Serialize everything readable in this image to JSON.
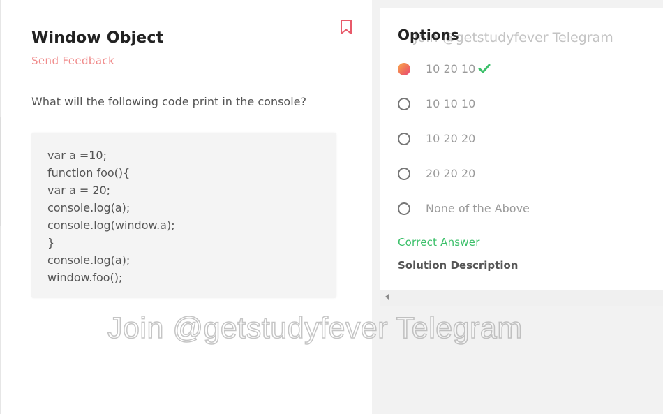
{
  "question": {
    "title": "Window Object",
    "feedback_label": "Send Feedback",
    "prompt": "What will the following code print in the console?",
    "code_lines": [
      "var a =10;",
      "function foo(){",
      "var a = 20;",
      "console.log(a);",
      "console.log(window.a);",
      "}",
      "console.log(a);",
      "window.foo();"
    ]
  },
  "options_panel": {
    "heading": "Options",
    "options": [
      {
        "label": "10 20 10",
        "selected": true,
        "correct": true
      },
      {
        "label": "10 10 10",
        "selected": false
      },
      {
        "label": "10 20 20",
        "selected": false
      },
      {
        "label": "20 20 20",
        "selected": false
      },
      {
        "label": "None of the Above",
        "selected": false
      }
    ],
    "correct_answer_label": "Correct Answer",
    "solution_label": "Solution Description"
  },
  "watermarks": {
    "top": "Join @getstudyfever Telegram",
    "center": "Join @getstudyfever Telegram"
  },
  "icons": {
    "bookmark": "bookmark-icon",
    "check": "check-icon",
    "scroll_left": "chevron-left-icon"
  },
  "colors": {
    "accent_feedback": "#f08a8a",
    "correct_green": "#3cc06a",
    "bookmark_red": "#e85a6a",
    "selected_gradient_start": "#f9aa4b",
    "selected_gradient_end": "#e8457a"
  }
}
